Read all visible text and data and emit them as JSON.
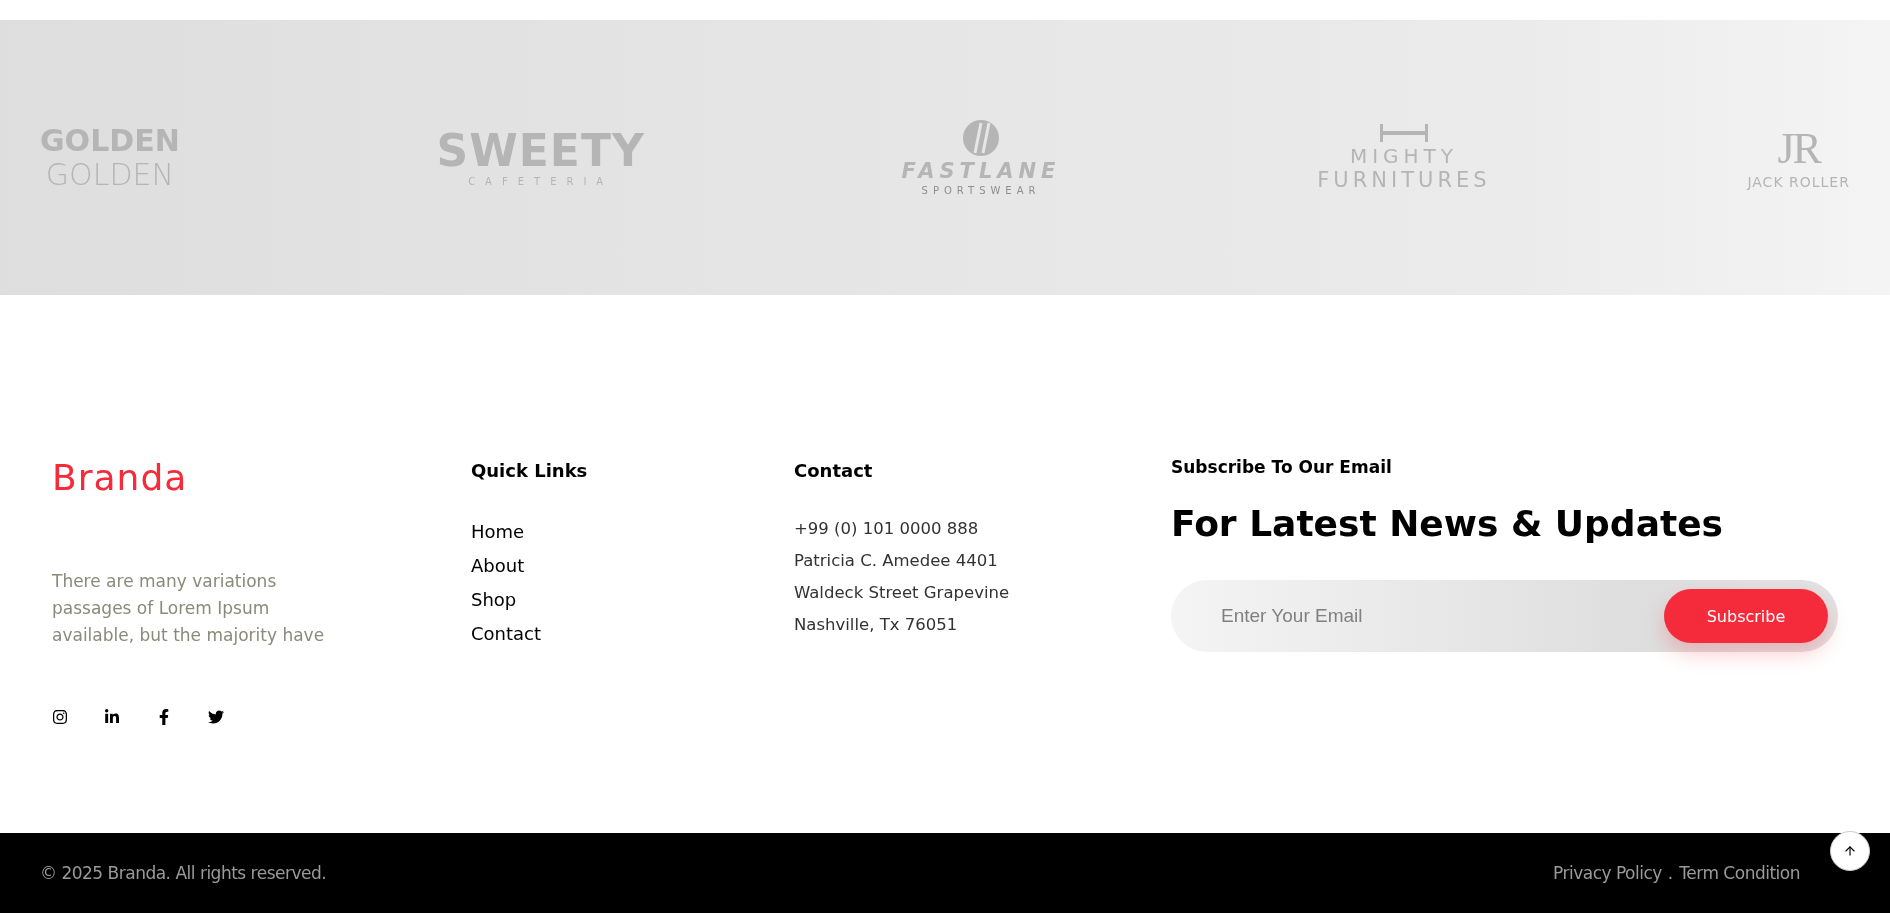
{
  "logos": [
    {
      "kind": "mirrored",
      "title": "GOLDEN",
      "subtitle": "GOLDEN"
    },
    {
      "kind": "plain",
      "title": "SWEETY",
      "subtitle": "CAFETERIA"
    },
    {
      "kind": "stripes",
      "title": "FASTLANE",
      "subtitle": "SPORTSWEAR"
    },
    {
      "kind": "bed",
      "title": "MIGHTY",
      "subtitle": "FURNITURES"
    },
    {
      "kind": "serif",
      "title": "JR",
      "subtitle": "JACK ROLLER"
    }
  ],
  "brand": {
    "name": "Branda",
    "description": "There are many variations passages of Lorem Ipsum available, but the majority have"
  },
  "social": [
    {
      "kind": "instagram"
    },
    {
      "kind": "linkedin"
    },
    {
      "kind": "facebook"
    },
    {
      "kind": "twitter"
    }
  ],
  "quick_links": {
    "title": "Quick Links",
    "items": [
      "Home",
      "About",
      "Shop",
      "Contact"
    ]
  },
  "contact": {
    "title": "Contact",
    "lines": [
      "+99 (0) 101 0000 888",
      "Patricia C. Amedee 4401",
      "Waldeck Street Grapevine",
      "Nashville, Tx 76051"
    ]
  },
  "subscribe": {
    "eyebrow": "Subscribe To Our Email",
    "heading": "For Latest News & Updates",
    "placeholder": "Enter Your Email",
    "button": "Subscribe"
  },
  "bottom_bar": {
    "copyright": "© 2025 Branda. All rights reserved.",
    "links": [
      "Privacy Policy",
      "Term Condition"
    ],
    "separator": "."
  }
}
